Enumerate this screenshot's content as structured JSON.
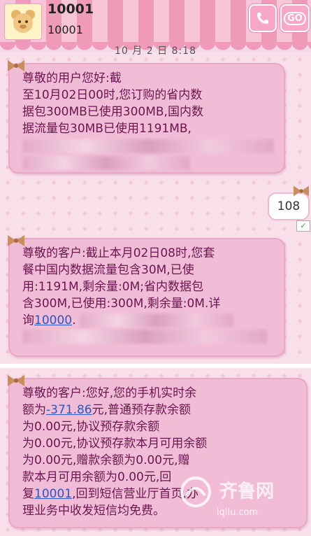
{
  "header": {
    "contact_name": "10001",
    "contact_number": "10001",
    "call_icon": "phone-icon",
    "go_label": "GO"
  },
  "timestamp": "10 月 2 日  8:18",
  "messages": [
    {
      "direction": "incoming",
      "text": "尊敬的用户您好:截\n至10月02日00时,您订购的省内数\n据包300MB已使用300MB,国内数\n据流量包30MB已使用1191MB,"
    },
    {
      "direction": "outgoing",
      "text": "108"
    },
    {
      "direction": "incoming",
      "text_before_link": "尊敬的客户:截止本月02日08时,您套\n餐中国内数据流量包含30M,已使\n用:1191M,剩余量:0M;省内数据包\n含300M,已使用:300M,剩余量:0M.详\n询",
      "link": "10000",
      "text_after_link": "."
    },
    {
      "direction": "incoming",
      "line1": "尊敬的客户:您好,您的手机实时余",
      "line2_before": "额为",
      "balance_link": "-371.86",
      "line2_after": "元,普通预存款余额",
      "line3_to_5": "为0.00元,协议预存款余额\n为0.00元,协议预存款本月可用余额\n为0.00元,赠款余额为0.00元,赠\n款本月可用余额为0.00元,回",
      "line6_before": "复",
      "reply_link": "10001",
      "line6_after": ",回到短信营业厅首页,办",
      "line7": "理业务中收发短信均免费。"
    }
  ],
  "watermark": {
    "brand": "齐鲁网",
    "url": "iqilu.com"
  },
  "colors": {
    "bubble": "#f1bcd6",
    "text": "#6a1450",
    "link": "#2a56c6",
    "header_stripe_a": "#f7c4d8",
    "header_stripe_b": "#f09ab9"
  }
}
